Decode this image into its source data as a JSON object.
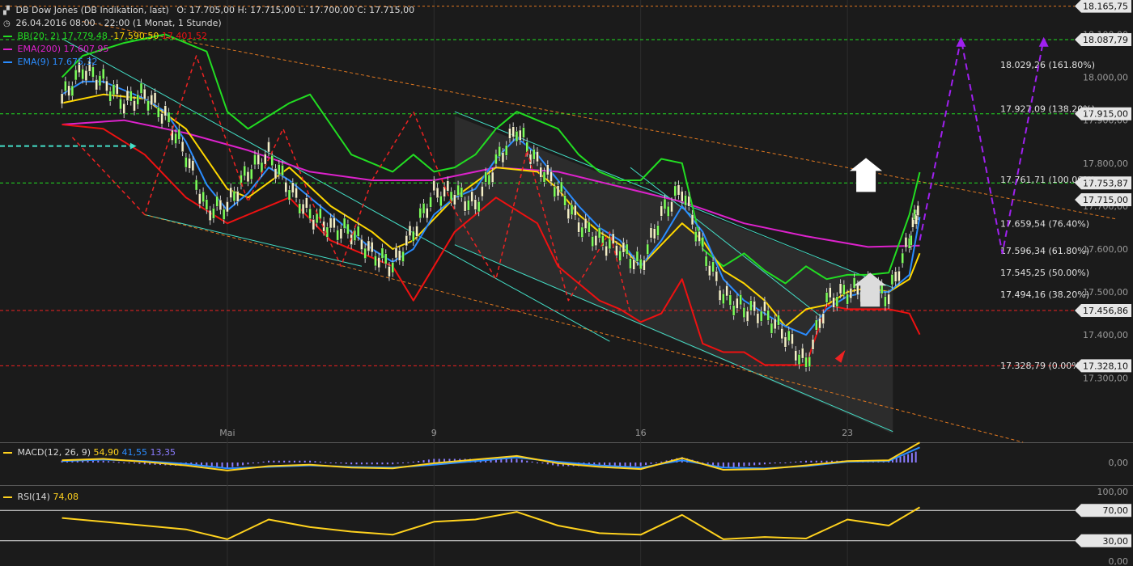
{
  "header": {
    "instrument": "DB Dow Jones (DB Indikation, last)",
    "ohlc": "O: 17.705,00   H: 17.715,00   L: 17.700,00   C: 17.715,00",
    "period": "26.04.2016 08:00 - 22:00 (1 Monat, 1 Stunde)"
  },
  "legend": {
    "bb_label": "BB(20; 2)",
    "bb_values": "17.779,48",
    "bb_mid": "17.590,50",
    "bb_low": "17.401,52",
    "ema200_label": "EMA(200)",
    "ema200_value": "17.607,95",
    "ema9_label": "EMA(9)",
    "ema9_value": "17.675,32",
    "macd_label": "MACD(12, 26, 9)",
    "macd_v1": "54,90",
    "macd_v2": "41,55",
    "macd_v3": "13,35",
    "rsi_label": "RSI(14)",
    "rsi_value": "74,08"
  },
  "colors": {
    "background": "#1b1b1b",
    "bb": "#22dd22",
    "bb_mid": "#ffd700",
    "bb_low": "#ee1111",
    "ema200": "#dd22cc",
    "ema9": "#2a8cff",
    "channel": "#44e0c8",
    "fib": "#e07820",
    "forecast": "#a020f0",
    "macd": "#ffd21e",
    "macd_signal": "#2a8cff",
    "macd_hist": "#8a7cff",
    "rsi": "#ffd21e"
  },
  "chart_data": {
    "type": "line",
    "title": "DB Dow Jones (DB Indikation, last)",
    "xlabel": "",
    "ylabel": "",
    "ylim": [
      17150,
      18180
    ],
    "x_ticks": [
      {
        "label": "Mai",
        "x": 11
      },
      {
        "label": "9",
        "x": 21
      },
      {
        "label": "16",
        "x": 31
      },
      {
        "label": "23",
        "x": 41
      }
    ],
    "y_ticks": [
      "17.300,00",
      "17.400,00",
      "17.500,00",
      "17.600,00",
      "17.700,00",
      "17.800,00",
      "17.900,00",
      "18.000,00",
      "18.100,00"
    ],
    "y_tick_values": [
      17300,
      17400,
      17500,
      17600,
      17700,
      17800,
      17900,
      18000,
      18100
    ],
    "series": [
      {
        "name": "EMA(200)",
        "x": [
          3,
          6,
          9,
          12,
          15,
          18,
          21,
          24,
          27,
          30,
          33,
          36,
          39,
          42,
          44.5
        ],
        "values": [
          17890,
          17900,
          17870,
          17830,
          17780,
          17760,
          17760,
          17790,
          17780,
          17745,
          17710,
          17660,
          17630,
          17605,
          17608
        ]
      },
      {
        "name": "BB(20; 2)",
        "x": [
          3,
          4,
          6,
          8,
          10,
          11,
          12,
          13,
          14,
          15,
          17,
          19,
          20,
          21,
          22,
          23,
          24,
          25,
          26,
          27,
          28,
          29,
          30,
          31,
          32,
          33,
          34,
          35,
          36,
          37,
          38,
          39,
          40,
          41,
          42,
          43,
          44,
          44.5
        ],
        "values": [
          18000,
          18050,
          18080,
          18100,
          18060,
          17920,
          17880,
          17910,
          17940,
          17960,
          17820,
          17780,
          17820,
          17780,
          17790,
          17820,
          17880,
          17920,
          17900,
          17880,
          17820,
          17780,
          17760,
          17760,
          17810,
          17800,
          17600,
          17560,
          17590,
          17550,
          17520,
          17560,
          17530,
          17540,
          17540,
          17545,
          17680,
          17779
        ]
      },
      {
        "name": "BB mid",
        "x": [
          3,
          5,
          7,
          9,
          11,
          12,
          14,
          16,
          18,
          19,
          20,
          21,
          22,
          24,
          26,
          27,
          28,
          29,
          30,
          31,
          32,
          33,
          34,
          35,
          36,
          37,
          38,
          39,
          40,
          41,
          42,
          43,
          44,
          44.5
        ],
        "values": [
          17940,
          17960,
          17950,
          17880,
          17740,
          17720,
          17790,
          17700,
          17640,
          17600,
          17620,
          17670,
          17720,
          17790,
          17780,
          17740,
          17680,
          17640,
          17610,
          17560,
          17610,
          17660,
          17620,
          17550,
          17520,
          17480,
          17420,
          17460,
          17470,
          17500,
          17510,
          17500,
          17530,
          17590
        ]
      },
      {
        "name": "BB low",
        "x": [
          3,
          5,
          7,
          9,
          11,
          12,
          14,
          16,
          18,
          19,
          20,
          21,
          22,
          24,
          26,
          27,
          28,
          29,
          30,
          31,
          32,
          33,
          34,
          35,
          36,
          37,
          38,
          39,
          40,
          41,
          42,
          43,
          44,
          44.5
        ],
        "values": [
          17890,
          17880,
          17820,
          17720,
          17660,
          17680,
          17720,
          17620,
          17580,
          17560,
          17480,
          17560,
          17640,
          17720,
          17660,
          17560,
          17520,
          17480,
          17460,
          17430,
          17450,
          17530,
          17380,
          17360,
          17360,
          17330,
          17330,
          17330,
          17470,
          17460,
          17460,
          17460,
          17450,
          17401
        ]
      },
      {
        "name": "EMA(9)",
        "x": [
          3,
          4,
          5,
          6,
          7,
          8,
          9,
          10,
          11,
          12,
          13,
          14,
          15,
          16,
          17,
          18,
          19,
          20,
          21,
          22,
          23,
          24,
          25,
          26,
          27,
          28,
          29,
          30,
          31,
          32,
          33,
          34,
          35,
          36,
          37,
          38,
          39,
          40,
          41,
          42,
          43,
          44,
          44.5
        ],
        "values": [
          17960,
          17990,
          17990,
          17970,
          17950,
          17920,
          17850,
          17750,
          17690,
          17730,
          17790,
          17760,
          17720,
          17680,
          17640,
          17600,
          17570,
          17600,
          17680,
          17720,
          17740,
          17810,
          17860,
          17820,
          17760,
          17700,
          17650,
          17620,
          17560,
          17620,
          17700,
          17640,
          17530,
          17480,
          17450,
          17420,
          17400,
          17460,
          17490,
          17500,
          17500,
          17540,
          17675
        ]
      },
      {
        "name": "Kurs",
        "x": [
          3,
          4,
          5,
          6,
          7,
          8,
          9,
          10,
          11,
          12,
          13,
          14,
          15,
          16,
          17,
          18,
          19,
          20,
          21,
          22,
          23,
          24,
          25,
          26,
          27,
          28,
          29,
          30,
          31,
          32,
          33,
          34,
          35,
          36,
          37,
          38,
          39,
          40,
          41,
          42,
          43,
          44,
          44.5
        ],
        "values": [
          17950,
          18020,
          17990,
          17940,
          17960,
          17910,
          17820,
          17690,
          17700,
          17780,
          17820,
          17740,
          17680,
          17650,
          17640,
          17590,
          17560,
          17640,
          17730,
          17730,
          17700,
          17800,
          17880,
          17800,
          17740,
          17660,
          17620,
          17600,
          17560,
          17680,
          17740,
          17600,
          17490,
          17460,
          17450,
          17400,
          17330,
          17480,
          17500,
          17510,
          17490,
          17620,
          17715
        ]
      }
    ],
    "h_levels": [
      {
        "label": "18.165,75",
        "value": 18165.75,
        "style": "orange"
      },
      {
        "label": "18.087,79",
        "value": 18087.79,
        "style": "green"
      },
      {
        "label": "17.915,00",
        "value": 17915.0,
        "style": "green"
      },
      {
        "label": "17.753,87",
        "value": 17753.87,
        "style": "green"
      },
      {
        "label": "17.715,00",
        "value": 17715.0,
        "style": "white"
      },
      {
        "label": "17.456,86",
        "value": 17456.86,
        "style": "red"
      },
      {
        "label": "17.328,10",
        "value": 17328.1,
        "style": "red"
      }
    ],
    "fib_levels": [
      {
        "label": "18.029,26 (161.80%)",
        "value": 18029.26
      },
      {
        "label": "17.927,09 (138.20%)",
        "value": 17927.09
      },
      {
        "label": "17.761,71 (100.00%)",
        "value": 17761.71
      },
      {
        "label": "17.659,54 (76.40%)",
        "value": 17659.54
      },
      {
        "label": "17.596,34 (61.80%)",
        "value": 17596.34
      },
      {
        "label": "17.545,25 (50.00%)",
        "value": 17545.25
      },
      {
        "label": "17.494,16 (38.20%)",
        "value": 17494.16
      },
      {
        "label": "17.328,79 (0.00%)",
        "value": 17328.79
      }
    ],
    "forecast": {
      "x": [
        44.5,
        46.5,
        48.5,
        50.5
      ],
      "values": [
        17620,
        18090,
        17590,
        18090
      ]
    },
    "macd": {
      "y_tick": "0,00",
      "x": [
        3,
        5,
        7,
        9,
        11,
        13,
        15,
        17,
        19,
        21,
        23,
        25,
        27,
        29,
        31,
        33,
        35,
        37,
        39,
        41,
        43,
        44.5
      ],
      "macd": [
        6,
        10,
        2,
        -8,
        -22,
        -10,
        -6,
        -14,
        -16,
        -2,
        8,
        18,
        -2,
        -12,
        -18,
        12,
        -20,
        -18,
        -8,
        4,
        6,
        54.9
      ],
      "signal": [
        4,
        8,
        4,
        -4,
        -16,
        -12,
        -8,
        -12,
        -14,
        -6,
        4,
        14,
        2,
        -8,
        -14,
        6,
        -14,
        -16,
        -10,
        2,
        4,
        41.55
      ]
    },
    "rsi": {
      "y_ticks": [
        "100,00",
        "70,00",
        "30,00",
        "0,00"
      ],
      "y_tick_values": [
        100,
        70,
        30,
        0
      ],
      "x": [
        3,
        5,
        7,
        9,
        11,
        13,
        15,
        17,
        19,
        21,
        23,
        25,
        27,
        29,
        31,
        33,
        35,
        37,
        39,
        41,
        43,
        44.5
      ],
      "values": [
        60,
        55,
        50,
        45,
        32,
        58,
        48,
        42,
        38,
        55,
        58,
        68,
        50,
        40,
        38,
        64,
        32,
        35,
        33,
        58,
        50,
        74.08
      ]
    }
  }
}
